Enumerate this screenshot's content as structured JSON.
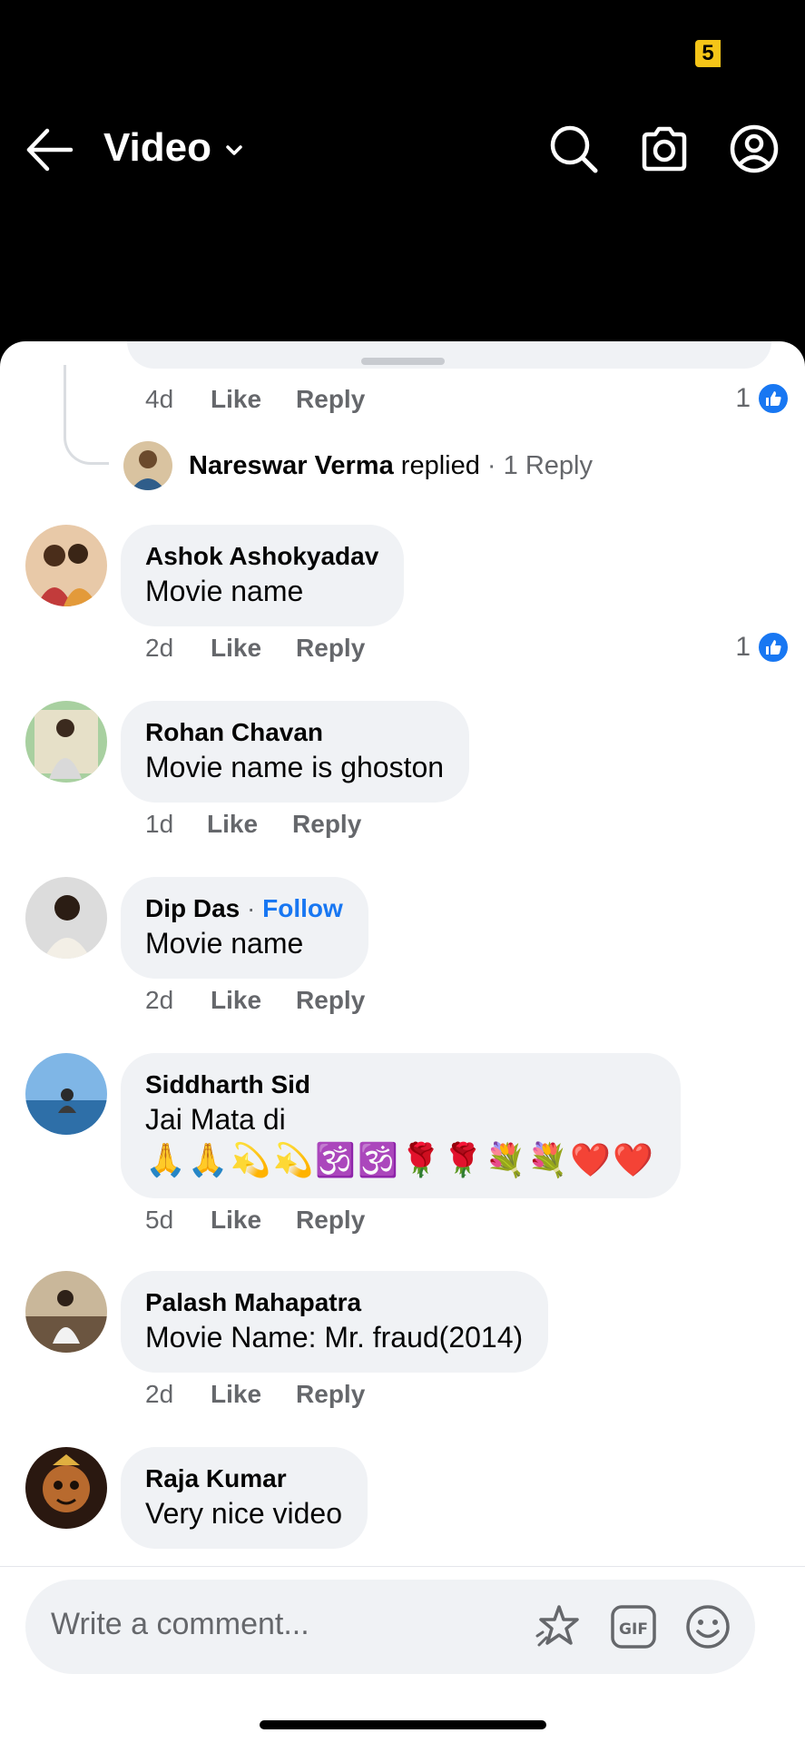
{
  "status": {
    "badge": "5"
  },
  "header": {
    "title": "Video"
  },
  "thread": {
    "meta": {
      "time": "4d",
      "like": "Like",
      "reply": "Reply",
      "reaction_count": "1"
    },
    "reply_summary": {
      "name": "Nareswar Verma",
      "verb": "replied",
      "sep": "·",
      "count": "1 Reply"
    }
  },
  "comments": [
    {
      "author": "Ashok Ashokyadav",
      "text": "Movie name",
      "time": "2d",
      "like": "Like",
      "reply": "Reply",
      "reactions": "1"
    },
    {
      "author": "Rohan Chavan",
      "text": "Movie name is ghoston",
      "time": "1d",
      "like": "Like",
      "reply": "Reply"
    },
    {
      "author": "Dip Das",
      "sep": "·",
      "follow": "Follow",
      "text": "Movie name",
      "time": "2d",
      "like": "Like",
      "reply": "Reply"
    },
    {
      "author": "Siddharth Sid",
      "text": "Jai Mata di",
      "emoji": "🙏🙏💫💫🕉️🕉️🌹🌹💐💐❤️❤️",
      "time": "5d",
      "like": "Like",
      "reply": "Reply"
    },
    {
      "author": "Palash Mahapatra",
      "text": "Movie Name: Mr. fraud(2014)",
      "time": "2d",
      "like": "Like",
      "reply": "Reply"
    },
    {
      "author": "Raja Kumar",
      "text": "Very nice video"
    }
  ],
  "composer": {
    "placeholder": "Write a comment..."
  },
  "colors": {
    "accent": "#1877f2",
    "bubble": "#f0f2f5",
    "muted": "#65676b"
  },
  "icons": [
    "back-arrow-icon",
    "chevron-down-icon",
    "search-icon",
    "camera-icon",
    "profile-icon",
    "like-icon",
    "sticker-icon",
    "gif-icon",
    "emoji-icon"
  ]
}
